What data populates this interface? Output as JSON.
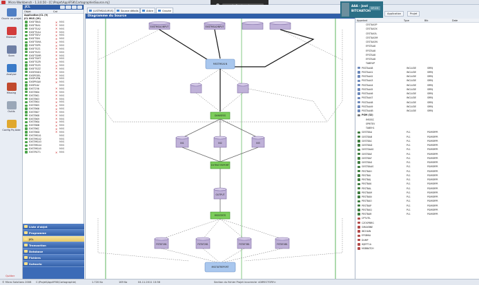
{
  "window": {
    "title": "Micro Workbench - 1.3.0.50 - [C:\\Projet\\AppliFSK\\Cartographie\\Source.mj]"
  },
  "meeting_bar": {
    "label": "Arrêter le partage"
  },
  "user_badge": {
    "line1": "AAA - José",
    "line2": "BITCHATCHI",
    "time": "07:23"
  },
  "rail": {
    "items": [
      {
        "label": "Ouvrir un projet",
        "icon": "folder-open-icon",
        "color": "#4f7fc4"
      },
      {
        "label": "Browser",
        "icon": "browser-icon",
        "color": "#d23b3b"
      },
      {
        "label": "Scan",
        "icon": "magnifier-icon",
        "color": "#6e7fa5"
      },
      {
        "label": "Analyse",
        "icon": "chart-icon",
        "color": "#3a7bc8"
      },
      {
        "label": "Missing",
        "icon": "books-icon",
        "color": "#c14a2e"
      },
      {
        "label": "Outils",
        "icon": "tools-icon",
        "color": "#9aa7b8"
      },
      {
        "label": "Config Pq Aide",
        "icon": "help-icon",
        "color": "#e0a82e"
      }
    ],
    "quit_label": "Quitter"
  },
  "tree": {
    "header": "JCL",
    "columns": [
      "Objet",
      "Cat"
    ],
    "groups": [
      "Application JCL (9)",
      "JCL MVS (29)"
    ],
    "rows": [
      {
        "name": "EXSFT8KA",
        "x": true,
        "type": "MVS"
      },
      {
        "name": "EXSFT8A1",
        "x": true,
        "type": "MVS"
      },
      {
        "name": "EXSFTSA2",
        "x": true,
        "type": "MVS"
      },
      {
        "name": "EXSFTSA4",
        "x": true,
        "type": "MVS"
      },
      {
        "name": "EXSFTSEV",
        "x": true,
        "type": "MVS"
      },
      {
        "name": "EXSFTSIN",
        "x": true,
        "type": "MVS"
      },
      {
        "name": "EXSFTSMA",
        "x": true,
        "type": "MVS"
      },
      {
        "name": "EXSFTSPR",
        "x": true,
        "type": "MVS"
      },
      {
        "name": "EXSFTSZ1",
        "x": true,
        "type": "MVS"
      },
      {
        "name": "EXSFTSZ2",
        "x": true,
        "type": "MVS"
      },
      {
        "name": "EXSFTSMR",
        "x": true,
        "type": "MVS"
      },
      {
        "name": "EXSFTSMT",
        "x": true,
        "type": "MVS"
      },
      {
        "name": "EXSFTSZR",
        "x": true,
        "type": "MVS"
      },
      {
        "name": "EXSFTSZS",
        "x": true,
        "type": "MVS"
      },
      {
        "name": "EXSFTSZZ",
        "x": true,
        "type": "MVS"
      },
      {
        "name": "EXSFEND1",
        "x": true,
        "type": "MVS"
      },
      {
        "name": "EXSPEDEL",
        "x": true,
        "type": "MVS"
      },
      {
        "name": "EXSPUPIN",
        "x": true,
        "type": "MVS"
      },
      {
        "name": "EXSPRSAV",
        "x": true,
        "type": "MVS"
      },
      {
        "name": "EXSPSAV",
        "x": false,
        "type": "MVS"
      },
      {
        "name": "EXST236",
        "x": true,
        "type": "MVS"
      },
      {
        "name": "EXSTBK0",
        "x": true,
        "type": "MVS"
      },
      {
        "name": "EXSTBK1",
        "x": true,
        "type": "MVS"
      },
      {
        "name": "EXSTBK3",
        "x": true,
        "type": "MVS"
      },
      {
        "name": "EXSTBK4",
        "x": true,
        "type": "MVS"
      },
      {
        "name": "EXSTBK5",
        "x": true,
        "type": "MVS"
      },
      {
        "name": "EXSTBK6",
        "x": true,
        "type": "MVS"
      },
      {
        "name": "EXSTBK7",
        "x": true,
        "type": "MVS"
      },
      {
        "name": "EXSTBK8",
        "x": true,
        "type": "MVS"
      },
      {
        "name": "EXSTBK9",
        "x": true,
        "type": "MVS"
      },
      {
        "name": "EXSTBKA",
        "x": true,
        "type": "MVS"
      },
      {
        "name": "EXSTBKB",
        "x": true,
        "type": "MVS"
      },
      {
        "name": "EXSTBKC",
        "x": true,
        "type": "MVS"
      },
      {
        "name": "EXSTBKD",
        "x": true,
        "type": "MVS"
      },
      {
        "name": "EXSTMSA1",
        "x": false,
        "type": "MVS"
      },
      {
        "name": "EXSTMSA2",
        "x": false,
        "type": "MVS"
      },
      {
        "name": "EXSTMSA3",
        "x": false,
        "type": "MVS"
      },
      {
        "name": "EXSTMSA4",
        "x": false,
        "type": "MVS"
      },
      {
        "name": "EXSTMSA5",
        "x": false,
        "type": "MVS"
      },
      {
        "name": "EXSTRCT1",
        "x": true,
        "type": "MVS"
      }
    ]
  },
  "nav": {
    "items": [
      "Liste d'objet",
      "Programme",
      "JCL",
      "Transaction",
      "Database",
      "Fichiers",
      "Scénario"
    ],
    "active_index": 2
  },
  "doc_tabs": [
    "(LISTMSA3.MVS)",
    "Source détails",
    "Arbre",
    "Graphe"
  ],
  "canvas": {
    "caption": "Diagramme du Source"
  },
  "right_panel": {
    "tabs": [
      "Application",
      "Projet"
    ],
    "columns": [
      "Appelant",
      "Type",
      "Bib",
      "Date"
    ],
    "rows": [
      {
        "name": "CESTAA3P",
        "type": "",
        "bib": "",
        "icon": "none"
      },
      {
        "name": "CESTAA3X",
        "type": "",
        "bib": "",
        "icon": "none"
      },
      {
        "name": "CESTAA3L",
        "type": "",
        "bib": "",
        "icon": "none"
      },
      {
        "name": "CESTAA3M",
        "type": "",
        "bib": "",
        "icon": "none"
      },
      {
        "name": "CESTAA3N",
        "type": "",
        "bib": "",
        "icon": "none"
      },
      {
        "name": "EFSTAA8",
        "type": "",
        "bib": "",
        "icon": "none"
      },
      {
        "name": "EFSTAA8",
        "type": "",
        "bib": "",
        "icon": "none"
      },
      {
        "name": "EFSTAA8",
        "type": "",
        "bib": "",
        "icon": "none"
      },
      {
        "name": "EFSTAA8",
        "type": "",
        "bib": "",
        "icon": "none"
      },
      {
        "name": "TABEVIP",
        "type": "",
        "bib": "",
        "icon": "none"
      },
      {
        "name": "PSSTAAA8",
        "type": "INCLUDE",
        "bib": "SRRIJ",
        "icon": "doc"
      },
      {
        "name": "PSSTAAA1",
        "type": "INCLUDE",
        "bib": "SRRIJ",
        "icon": "doc"
      },
      {
        "name": "PSSTAAA2",
        "type": "INCLUDE",
        "bib": "SRRIJ",
        "icon": "doc"
      },
      {
        "name": "PSSTAAA3",
        "type": "INCLUDE",
        "bib": "SRRIJ",
        "icon": "doc"
      },
      {
        "name": "PSSTAAA4",
        "type": "INCLUDE",
        "bib": "SRRIJ",
        "icon": "doc"
      },
      {
        "name": "PSSTAAA5",
        "type": "INCLUDE",
        "bib": "SRRIJ",
        "icon": "doc"
      },
      {
        "name": "PSSTAAA6",
        "type": "INCLUDE",
        "bib": "SRRIJ",
        "icon": "doc"
      },
      {
        "name": "PSSTAAA7",
        "type": "INCLUDE",
        "bib": "SRRIJ",
        "icon": "doc"
      },
      {
        "name": "PSSTAAA8",
        "type": "INCLUDE",
        "bib": "SRRIJ",
        "icon": "doc"
      },
      {
        "name": "PSSTAAA9",
        "type": "INCLUDE",
        "bib": "SRRIJ",
        "icon": "doc"
      },
      {
        "name": "PSSTAAAB",
        "type": "INCLUDE",
        "bib": "SRRIJ",
        "icon": "doc"
      },
      {
        "name": "PGM (32)",
        "type": "",
        "bib": "",
        "icon": "node"
      },
      {
        "name": "IMSSSC",
        "type": "",
        "bib": "",
        "icon": "none"
      },
      {
        "name": "SPRITEV",
        "type": "",
        "bib": "",
        "icon": "none"
      },
      {
        "name": "TABEH1",
        "type": "",
        "bib": "",
        "icon": "none"
      },
      {
        "name": "GESTBAA",
        "type": "PL1",
        "bib": "PGMSRPR",
        "icon": "pgm"
      },
      {
        "name": "GESTBAB",
        "type": "PL1",
        "bib": "PGMSRPR",
        "icon": "pgm"
      },
      {
        "name": "GESTBAC",
        "type": "PL1",
        "bib": "PGMSRPR",
        "icon": "pgm"
      },
      {
        "name": "GESTBAD",
        "type": "PL1",
        "bib": "PGMSRPR",
        "icon": "pgm"
      },
      {
        "name": "GESTDAAS",
        "type": "PL1",
        "bib": "PGMSRPR",
        "icon": "pgm"
      },
      {
        "name": "GESTBAE",
        "type": "PL1",
        "bib": "PGMSRPR",
        "icon": "pgm"
      },
      {
        "name": "GESTBAF",
        "type": "PL1",
        "bib": "PGMSRPR",
        "icon": "pgm"
      },
      {
        "name": "GESTBAG",
        "type": "PL1",
        "bib": "PGMSRPR",
        "icon": "pgm"
      },
      {
        "name": "GESTBAAS",
        "type": "PL1",
        "bib": "PGMSRPR",
        "icon": "pgm"
      },
      {
        "name": "PESTBAH",
        "type": "PL1",
        "bib": "PGMSRPR",
        "icon": "pgm"
      },
      {
        "name": "PESTBAI",
        "type": "PL1",
        "bib": "PGMSRPR",
        "icon": "pgm"
      },
      {
        "name": "PESTBAJ",
        "type": "PL1",
        "bib": "PGMSRPR",
        "icon": "pgm"
      },
      {
        "name": "PESTBAK",
        "type": "PL1",
        "bib": "PGMSRPR",
        "icon": "pgm"
      },
      {
        "name": "PESTBAL",
        "type": "PL1",
        "bib": "PGMSRPR",
        "icon": "pgm"
      },
      {
        "name": "PESTBAM",
        "type": "PL1",
        "bib": "PGMSRPR",
        "icon": "pgm"
      },
      {
        "name": "PESTBAN",
        "type": "PL1",
        "bib": "PGMSRPR",
        "icon": "pgm"
      },
      {
        "name": "PESTBAO",
        "type": "PL1",
        "bib": "PGMSRPR",
        "icon": "pgm"
      },
      {
        "name": "PESTBAP",
        "type": "PL1",
        "bib": "PGMSRPR",
        "icon": "pgm"
      },
      {
        "name": "PESTBAQ",
        "type": "PL1",
        "bib": "PGMSRPR",
        "icon": "pgm"
      },
      {
        "name": "PESTBAR",
        "type": "PL1",
        "bib": "PGMSRPR",
        "icon": "pgm"
      },
      {
        "name": "CPTUTIL",
        "type": "",
        "bib": "",
        "icon": "pgm2"
      },
      {
        "name": "CZOSPBRG",
        "type": "",
        "bib": "",
        "icon": "pgm2"
      },
      {
        "name": "GMAXBNE",
        "type": "",
        "bib": "",
        "icon": "pgm2"
      },
      {
        "name": "IBCHAIN",
        "type": "",
        "bib": "",
        "icon": "pgm2"
      },
      {
        "name": "EFSBIKA",
        "type": "",
        "bib": "",
        "icon": "pgm2"
      },
      {
        "name": "DUMP",
        "type": "",
        "bib": "",
        "icon": "pgm2"
      },
      {
        "name": "IKJEFT1A",
        "type": "",
        "bib": "",
        "icon": "pgm2"
      },
      {
        "name": "MSBBATCH",
        "type": "",
        "bib": "",
        "icon": "pgm2"
      }
    ]
  },
  "status": {
    "copyright": "© Micro Solutions 2008",
    "path": "C:\\Projet\\AppliFSK\\Cartographie\\",
    "size": "1.720 Ko",
    "size2": "169 Ko",
    "date": "04.11.2011 13:56",
    "section": "Section du fichier Projet incorrecte <DIRECTORY>"
  },
  "diagram": {
    "top_nodes": [
      "EXSTMSA1INPUT",
      "EXSTMSA2INPUT",
      "",
      ""
    ],
    "mid_node": "MSSTMSA1N",
    "dbs1": [
      "",
      ""
    ],
    "step1": "DANISESS",
    "dbs2": [
      "IN1",
      "IN2",
      "IN3"
    ],
    "step2": "EXTRAT REPORT",
    "db3": "OUTPUT",
    "step3": "MSSSTATS",
    "dbs4": [
      "FSTAT1B1",
      "FSTAT2B1",
      "FSTAT3B1",
      "FSTAT4B1"
    ],
    "bottom_node": "MSSTATREPORT",
    "colors": {
      "job": "#a9c7ee",
      "db": "#bfb1d8",
      "step": "#7ccd5b",
      "flow": "#111111",
      "frame": "#35a335"
    }
  }
}
